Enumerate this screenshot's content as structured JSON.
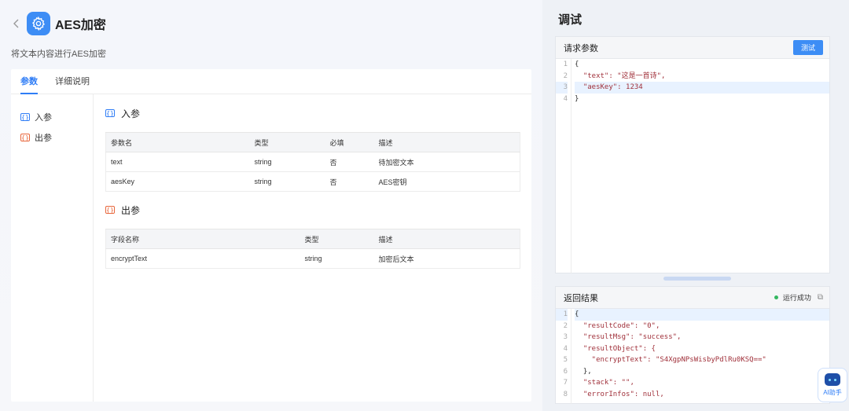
{
  "header": {
    "title": "AES加密",
    "subtitle": "将文本内容进行AES加密"
  },
  "tabs": [
    {
      "label": "参数",
      "active": true
    },
    {
      "label": "详细说明",
      "active": false
    }
  ],
  "side_nav": [
    {
      "label": "入参",
      "icon": "input-param-icon"
    },
    {
      "label": "出参",
      "icon": "output-param-icon"
    }
  ],
  "input_section": {
    "title": "入参",
    "columns": [
      "参数名",
      "类型",
      "必填",
      "描述"
    ],
    "rows": [
      [
        "text",
        "string",
        "否",
        "待加密文本"
      ],
      [
        "aesKey",
        "string",
        "否",
        "AES密钥"
      ]
    ]
  },
  "output_section": {
    "title": "出参",
    "columns": [
      "字段名称",
      "类型",
      "描述"
    ],
    "rows": [
      [
        "encryptText",
        "string",
        "加密后文本"
      ]
    ]
  },
  "debug": {
    "title": "调试",
    "request": {
      "title": "请求参数",
      "test_button": "测试",
      "line_numbers": [
        "1",
        "2",
        "3",
        "4"
      ],
      "lines": [
        "{",
        "  \"text\": \"这是一首诗\",",
        "  \"aesKey\": 1234",
        "}"
      ]
    },
    "response": {
      "title": "返回结果",
      "status": "运行成功",
      "line_numbers": [
        "1",
        "2",
        "3",
        "4",
        "5",
        "6",
        "7",
        "8"
      ],
      "lines": [
        "{",
        "  \"resultCode\": \"0\",",
        "  \"resultMsg\": \"success\",",
        "  \"resultObject\": {",
        "    \"encryptText\": \"S4XgpNPsWisbyPdlRu0KSQ==\"",
        "  },",
        "  \"stack\": \"\",",
        "  \"errorInfos\": null,"
      ]
    }
  },
  "ai_assistant": {
    "label": "AI助手"
  },
  "colors": {
    "accent": "#2f7df6",
    "success": "#34b760",
    "output": "#e8673c"
  }
}
